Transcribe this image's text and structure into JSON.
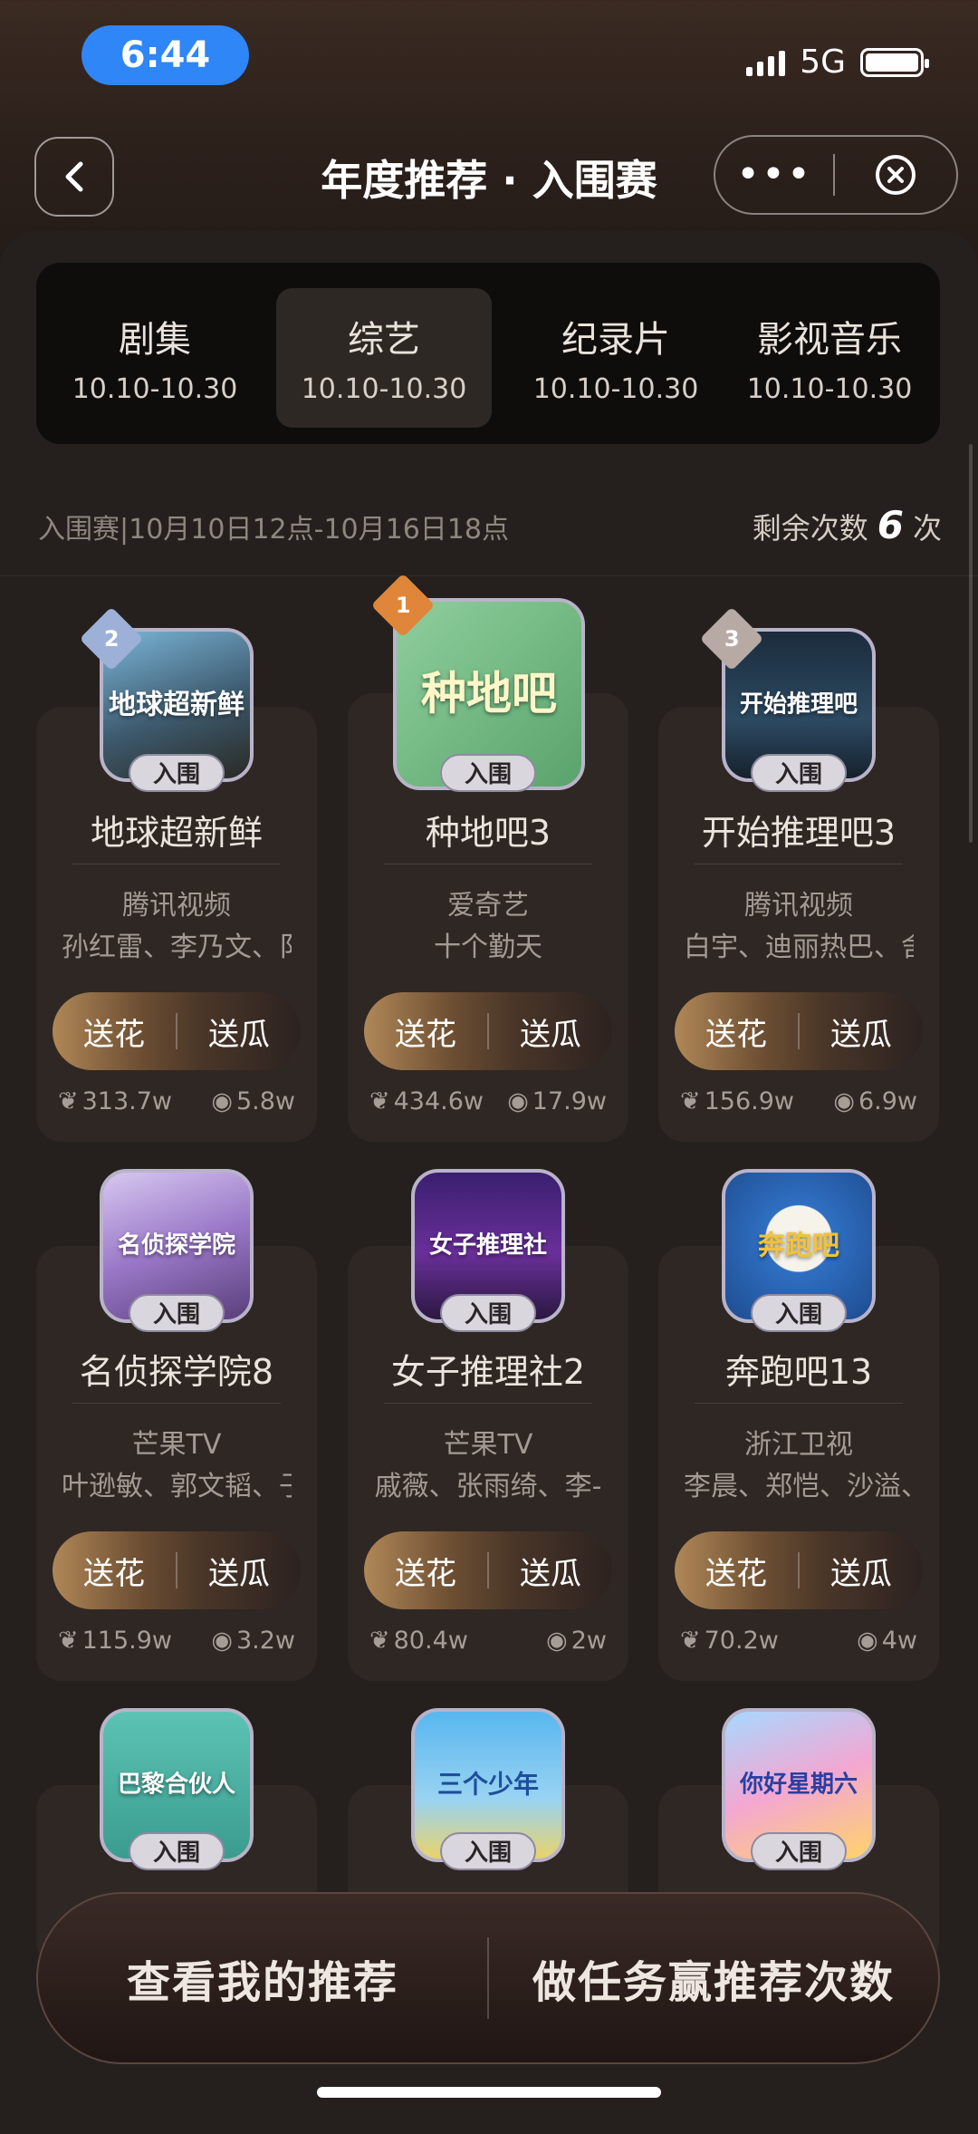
{
  "status_bar": {
    "time": "6:44",
    "network": "5G"
  },
  "nav": {
    "title": "年度推荐 · 入围赛",
    "more_label": "•••"
  },
  "categories": [
    {
      "name": "剧集",
      "date": "10.10-10.30"
    },
    {
      "name": "综艺",
      "date": "10.10-10.30"
    },
    {
      "name": "纪录片",
      "date": "10.10-10.30"
    },
    {
      "name": "影视音乐",
      "date": "10.10-10.30"
    }
  ],
  "active_category": "综艺",
  "info": {
    "period": "入围赛|10月10日12点-10月16日18点",
    "remaining_label": "剩余次数",
    "remaining_count": "6",
    "remaining_unit": "次"
  },
  "tag_label": "入围",
  "button_labels": {
    "flower": "送花",
    "melon": "送瓜"
  },
  "shows": [
    {
      "rank": "2",
      "cover_text": "地球超新鲜",
      "name": "地球超新鲜",
      "platform": "腾讯视频",
      "cast": "孙红雷、李乃文、阝",
      "flowers": "313.7w",
      "views": "5.8w"
    },
    {
      "rank": "1",
      "cover_text": "种地吧",
      "name": "种地吧3",
      "platform": "爱奇艺",
      "cast": "十个勤天",
      "flowers": "434.6w",
      "views": "17.9w"
    },
    {
      "rank": "3",
      "cover_text": "开始推理吧",
      "name": "开始推理吧3",
      "platform": "腾讯视频",
      "cast": "白宇、迪丽热巴、舍",
      "flowers": "156.9w",
      "views": "6.9w"
    },
    {
      "cover_text": "名侦探学院",
      "name": "名侦探学院8",
      "platform": "芒果TV",
      "cast": "叶逊敏、郭文韬、子",
      "flowers": "115.9w",
      "views": "3.2w"
    },
    {
      "cover_text": "女子推理社",
      "name": "女子推理社2",
      "platform": "芒果TV",
      "cast": "戚薇、张雨绮、李-",
      "flowers": "80.4w",
      "views": "2w"
    },
    {
      "cover_text": "奔跑吧",
      "name": "奔跑吧13",
      "platform": "浙江卫视",
      "cast": "李晨、郑恺、沙溢、",
      "flowers": "70.2w",
      "views": "4w"
    },
    {
      "cover_text": "巴黎合伙人"
    },
    {
      "cover_text": "三个少年"
    },
    {
      "cover_text": "你好星期六"
    }
  ],
  "bottom_actions": {
    "my_recommend": "查看我的推荐",
    "earn": "做任务赢推荐次数"
  },
  "colors": {
    "accent_blue": "#2f86f6",
    "gold": "#b08757",
    "rank1": "#e0863a",
    "rank2": "#9db0d8",
    "rank3": "#b7aaa4"
  }
}
